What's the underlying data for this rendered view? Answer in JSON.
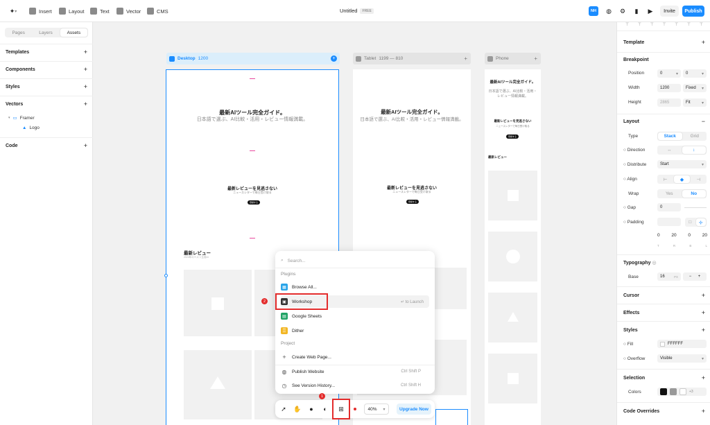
{
  "topbar": {
    "insert": "Insert",
    "layout": "Layout",
    "text": "Text",
    "vector": "Vector",
    "cms": "CMS",
    "title": "Untitled",
    "free": "FREE",
    "user": "NH",
    "invite": "Invite",
    "publish": "Publish"
  },
  "left": {
    "tabs": [
      "Pages",
      "Layers",
      "Assets"
    ],
    "sections": [
      "Templates",
      "Components",
      "Styles",
      "Vectors",
      "Code"
    ],
    "vectors": [
      "Framer",
      "Logo"
    ]
  },
  "canvas": {
    "desktop": {
      "label": "Desktop",
      "width": "1200"
    },
    "tablet": {
      "label": "Tablet",
      "size": "1199 — 810"
    },
    "phone": {
      "label": "Phone"
    },
    "heading": "最新AIツール完全ガイド。",
    "subheading": "日本語で選ぶ、AI比較・活用・レビュー情報満載。",
    "phone_heading": "最新AIツール完全ガイド。",
    "phone_sub": "日本語で選ぶ、AI比較・活用・レビュー情報満載。",
    "cta_heading": "最新レビューを見逃さない",
    "cta_sub": "ニュースレターで毎日受け取る",
    "cta_btn": "登録する",
    "review_heading": "最新レビュー",
    "review_sub": "2024年のベスト生成AI"
  },
  "popup": {
    "search_placeholder": "Search...",
    "plugins_label": "Plugins",
    "items": [
      "Browse All...",
      "Workshop",
      "Google Sheets",
      "Dither"
    ],
    "launch_hint": "to Launch",
    "project_label": "Project",
    "project_items": [
      "Create Web Page...",
      "Publish Website",
      "See Version History..."
    ],
    "shortcuts": [
      "Ctrl Shift P",
      "Ctrl Shift H"
    ]
  },
  "annotations": [
    "1",
    "2"
  ],
  "toolbar": {
    "zoom": "40%",
    "upgrade": "Upgrade Now"
  },
  "right": {
    "template": "Template",
    "breakpoint": "Breakpoint",
    "position": "Position",
    "pos_x": "0",
    "pos_y": "0",
    "width_label": "Width",
    "width": "1200",
    "width_mode": "Fixed",
    "height_label": "Height",
    "height": "2865",
    "height_mode": "Fit",
    "layout": "Layout",
    "type_label": "Type",
    "type_opts": [
      "Stack",
      "Grid"
    ],
    "direction": "Direction",
    "distribute": "Distribute",
    "distribute_val": "Start",
    "align": "Align",
    "wrap": "Wrap",
    "wrap_opts": [
      "Yes",
      "No"
    ],
    "gap": "Gap",
    "gap_val": "0",
    "padding": "Padding",
    "pad_vals": [
      "0",
      "20",
      "0",
      "20"
    ],
    "pad_labels": [
      "T",
      "R",
      "B",
      "L"
    ],
    "typography": "Typography",
    "base": "Base",
    "base_val": "16",
    "base_unit": "PX",
    "cursor": "Cursor",
    "effects": "Effects",
    "styles": "Styles",
    "fill": "Fill",
    "fill_val": "FFFFFF",
    "overflow": "Overflow",
    "overflow_val": "Visible",
    "selection": "Selection",
    "colors": "Colors",
    "colors_more": "+3",
    "code_overrides": "Code Overrides"
  }
}
